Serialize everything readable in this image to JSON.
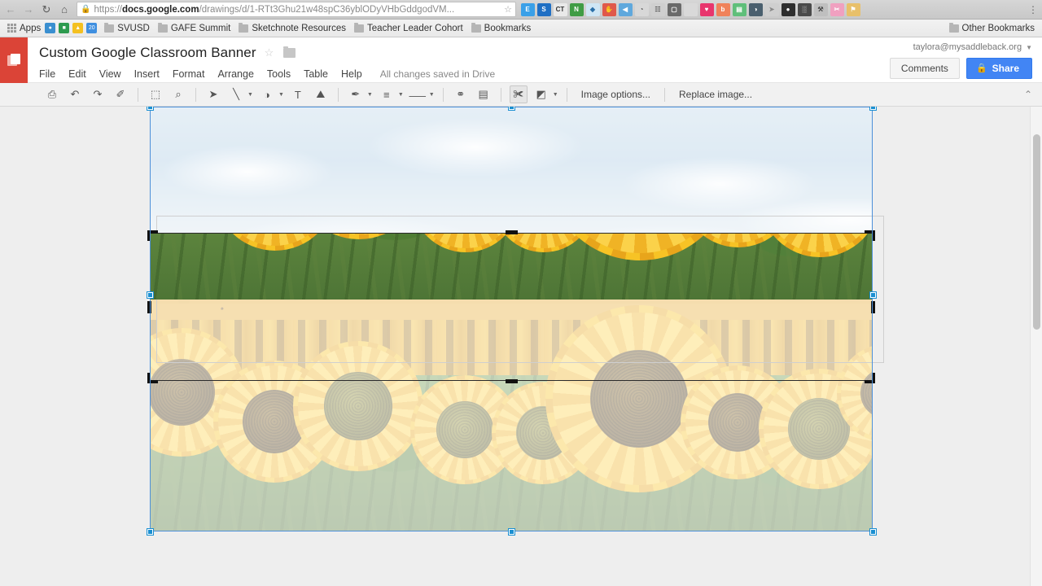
{
  "browser": {
    "nav": {
      "back_icon": "back-arrow-icon",
      "forward_icon": "forward-arrow-icon",
      "reload_icon": "reload-icon",
      "home_icon": "home-icon",
      "back_glyph": "←",
      "forward_glyph": "→",
      "reload_glyph": "↻",
      "home_glyph": "⌂"
    },
    "omnibox": {
      "lock_glyph": "🔒",
      "scheme": "https://",
      "host": "docs.google.com",
      "path": "/drawings/d/1-RTt3Ghu21w48spC36yblODyVHbGddgodVM...",
      "full_url": "https://docs.google.com/drawings/d/1-RTt3Ghu21w48spC36yblODyVHbGddgodVM...",
      "star_glyph": "☆",
      "star_name": "bookmark-star-icon"
    },
    "extensions": [
      {
        "name": "extension-evernote",
        "label": "E",
        "color": "#3aa0e8"
      },
      {
        "name": "extension-screencastify",
        "label": "S",
        "color": "#1f6fc4"
      },
      {
        "name": "extension-ct",
        "label": "CT",
        "color": "#e9e9e9",
        "text": "#333"
      },
      {
        "name": "extension-notebook",
        "label": "N",
        "color": "#3f9c45"
      },
      {
        "name": "extension-diigo",
        "label": "◆",
        "color": "#cfe6f5",
        "text": "#2a6fa8"
      },
      {
        "name": "extension-adblock",
        "label": "✋",
        "color": "#e0584a"
      },
      {
        "name": "extension-bluebird",
        "label": "◀",
        "color": "#5fa8dd"
      },
      {
        "name": "extension-clock",
        "label": "◔",
        "color": "#d8d8d8",
        "text": "#555"
      },
      {
        "name": "extension-grid",
        "label": "☷",
        "color": "#cfcfcf",
        "text": "#555"
      },
      {
        "name": "extension-pocket-gray",
        "label": "▢",
        "color": "#6a6a6a"
      },
      {
        "name": "extension-faded",
        "label": "",
        "color": "#d9d9d9"
      },
      {
        "name": "extension-heart",
        "label": "♥",
        "color": "#e8356d"
      },
      {
        "name": "extension-brand-orange",
        "label": "b",
        "color": "#f0825a"
      },
      {
        "name": "extension-green-book",
        "label": "▤",
        "color": "#5fbf7a"
      },
      {
        "name": "extension-moon",
        "label": "◑",
        "color": "#4a5f6e"
      },
      {
        "name": "extension-arrow-gray",
        "label": "➤",
        "color": "#cfcfcf",
        "text": "#888"
      },
      {
        "name": "extension-dark-circle",
        "label": "●",
        "color": "#2e2e2e"
      },
      {
        "name": "extension-film",
        "label": "░",
        "color": "#4a4a4a"
      },
      {
        "name": "extension-tools",
        "label": "⚒",
        "color": "#bfbfbf",
        "text": "#444"
      },
      {
        "name": "extension-pink",
        "label": "✂",
        "color": "#f0a0c0"
      },
      {
        "name": "extension-flag",
        "label": "⚑",
        "color": "#e8c06a"
      }
    ],
    "menu_glyph": "⋮",
    "bookmarks": {
      "apps_label": "Apps",
      "items": [
        {
          "name": "bookmark-svusd",
          "label": "SVUSD",
          "icon": "folder-icon"
        },
        {
          "name": "bookmark-gafe-summit",
          "label": "GAFE Summit",
          "icon": "folder-icon"
        },
        {
          "name": "bookmark-sketchnote-resources",
          "label": "Sketchnote Resources",
          "icon": "folder-icon"
        },
        {
          "name": "bookmark-teacher-leader-cohort",
          "label": "Teacher Leader Cohort",
          "icon": "folder-icon"
        },
        {
          "name": "bookmark-bookmarks",
          "label": "Bookmarks",
          "icon": "folder-icon"
        }
      ],
      "quick_icons": [
        {
          "name": "bookmark-icon-globe",
          "color": "#3a8fd0",
          "glyph": "●"
        },
        {
          "name": "bookmark-icon-contacts",
          "color": "#2e9b4f",
          "glyph": "■"
        },
        {
          "name": "bookmark-icon-drive",
          "color": "#f4c020",
          "glyph": "▲"
        },
        {
          "name": "bookmark-icon-calendar",
          "color": "#3f8fe0",
          "glyph": "20"
        }
      ],
      "other_bookmarks": "Other Bookmarks"
    }
  },
  "app": {
    "logo_name": "google-drawings-logo",
    "title": "Custom Google Classroom Banner",
    "star_glyph": "☆",
    "menus": [
      "File",
      "Edit",
      "View",
      "Insert",
      "Format",
      "Arrange",
      "Tools",
      "Table",
      "Help"
    ],
    "save_state": "All changes saved in Drive",
    "account_email": "taylora@mysaddleback.org",
    "account_caret": "▼",
    "comments_label": "Comments",
    "share_label": "Share",
    "share_lock_glyph": "🔒"
  },
  "toolbar": {
    "groups": [
      [
        {
          "name": "print-icon",
          "glyph": "⎙"
        },
        {
          "name": "undo-icon",
          "glyph": "↶"
        },
        {
          "name": "redo-icon",
          "glyph": "↷"
        },
        {
          "name": "paint-format-icon",
          "glyph": "✐"
        }
      ],
      [
        {
          "name": "canvas-resize-icon",
          "glyph": "⬚"
        },
        {
          "name": "zoom-icon",
          "glyph": "⌕"
        }
      ],
      [
        {
          "name": "select-arrow-icon",
          "glyph": "➤"
        },
        {
          "name": "line-tool-icon",
          "glyph": "╲",
          "caret": true
        },
        {
          "name": "shape-tool-icon",
          "glyph": "◑",
          "caret": true
        },
        {
          "name": "text-box-icon",
          "glyph": "T"
        },
        {
          "name": "insert-image-icon",
          "glyph": "⛰"
        }
      ],
      [
        {
          "name": "line-color-icon",
          "glyph": "✒",
          "caret": true
        },
        {
          "name": "line-weight-icon",
          "glyph": "≡",
          "caret": true
        },
        {
          "name": "line-dash-icon",
          "glyph": "⸺",
          "caret": true
        }
      ],
      [
        {
          "name": "insert-link-icon",
          "glyph": "⚭"
        },
        {
          "name": "insert-comment-icon",
          "glyph": "▤"
        }
      ],
      [
        {
          "name": "crop-image-icon",
          "glyph": "✀",
          "active": true
        },
        {
          "name": "mask-shape-icon",
          "glyph": "◩",
          "caret": true
        }
      ]
    ],
    "image_options_label": "Image options...",
    "replace_image_label": "Replace image...",
    "collapse_glyph": "⌃",
    "collapse_name": "collapse-toolbar-icon"
  },
  "canvas": {
    "image_name": "sunflower-field-image",
    "selection": {
      "mode": "crop",
      "handle_color": "#1a8fd1",
      "outline_color": "#4d90d9",
      "crop_handle_color": "#111111"
    }
  },
  "scrollbar": {
    "name": "vertical-scrollbar",
    "thumb_name": "vertical-scrollbar-thumb"
  }
}
